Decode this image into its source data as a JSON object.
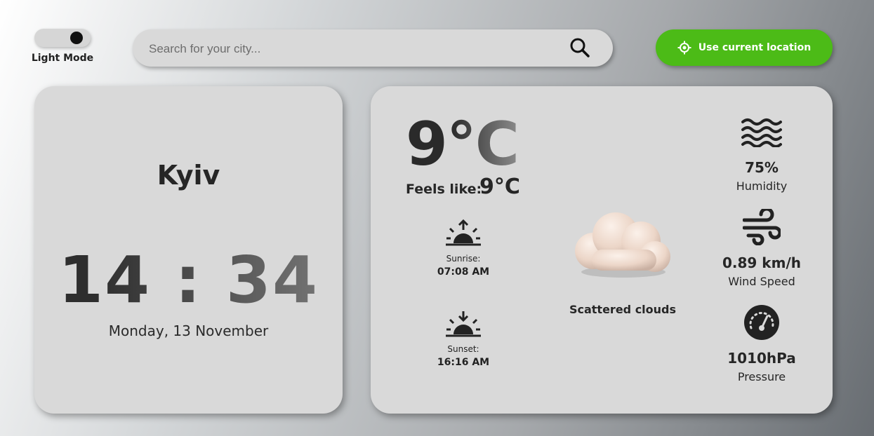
{
  "mode_toggle": {
    "label": "Light Mode"
  },
  "search": {
    "placeholder": "Search for your city..."
  },
  "location_button": {
    "label": "Use current location"
  },
  "city_card": {
    "city": "Kyiv",
    "time": "14 : 34",
    "date": "Monday, 13 November"
  },
  "weather": {
    "temperature": "9°C",
    "feels_like_label": "Feels like:",
    "feels_like_value": "9°C",
    "sunrise_label": "Sunrise:",
    "sunrise_time": "07:08 AM",
    "sunset_label": "Sunset:",
    "sunset_time": "16:16 AM",
    "description": "Scattered clouds",
    "humidity_value": "75%",
    "humidity_label": "Humidity",
    "wind_value": "0.89 km/h",
    "wind_label": "Wind Speed",
    "pressure_value": "1010hPa",
    "pressure_label": "Pressure"
  },
  "icons": [
    "search-icon",
    "crosshair-icon",
    "sunrise-icon",
    "sunset-icon",
    "cloud-icon",
    "waves-icon",
    "wind-icon",
    "gauge-icon"
  ],
  "colors": {
    "accent": "#4cbb17",
    "card": "#d9d9d9",
    "text": "#262626"
  }
}
